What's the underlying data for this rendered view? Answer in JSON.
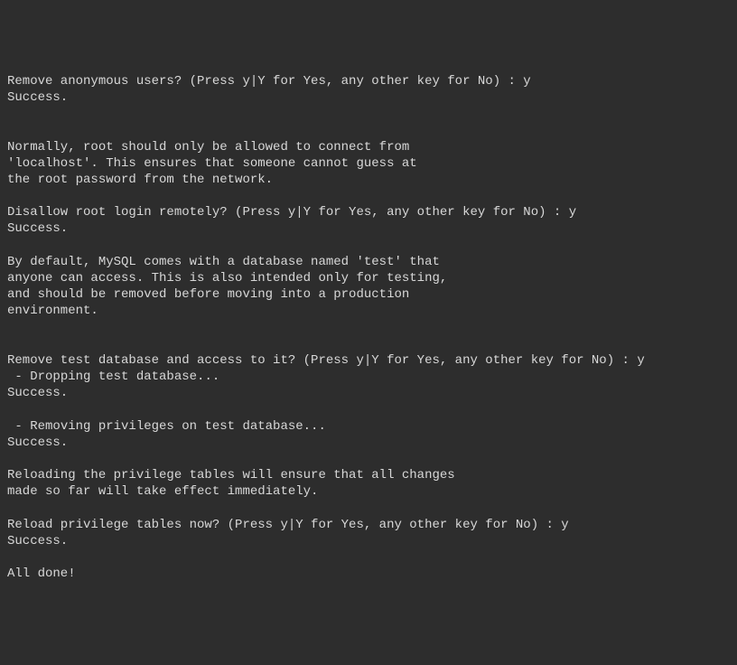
{
  "terminal": {
    "lines": [
      "Remove anonymous users? (Press y|Y for Yes, any other key for No) : y",
      "Success.",
      "",
      "",
      "Normally, root should only be allowed to connect from",
      "'localhost'. This ensures that someone cannot guess at",
      "the root password from the network.",
      "",
      "Disallow root login remotely? (Press y|Y for Yes, any other key for No) : y",
      "Success.",
      "",
      "By default, MySQL comes with a database named 'test' that",
      "anyone can access. This is also intended only for testing,",
      "and should be removed before moving into a production",
      "environment.",
      "",
      "",
      "Remove test database and access to it? (Press y|Y for Yes, any other key for No) : y",
      " - Dropping test database...",
      "Success.",
      "",
      " - Removing privileges on test database...",
      "Success.",
      "",
      "Reloading the privilege tables will ensure that all changes",
      "made so far will take effect immediately.",
      "",
      "Reload privilege tables now? (Press y|Y for Yes, any other key for No) : y",
      "Success.",
      "",
      "All done!"
    ]
  }
}
